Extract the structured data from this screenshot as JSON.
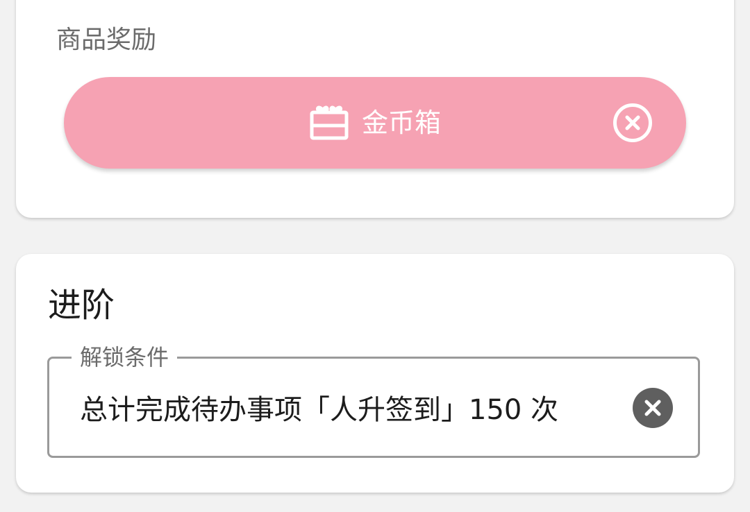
{
  "reward_section": {
    "label": "商品奖励",
    "item": {
      "label": "金币箱",
      "icon": "gift-box-icon",
      "remove_icon": "close-circle-outline-icon",
      "color": "#f6a2b3"
    }
  },
  "advanced_section": {
    "title": "进阶",
    "unlock_field": {
      "legend": "解锁条件",
      "value": "总计完成待办事项「人升签到」150 次",
      "clear_icon": "clear-circle-icon"
    }
  }
}
